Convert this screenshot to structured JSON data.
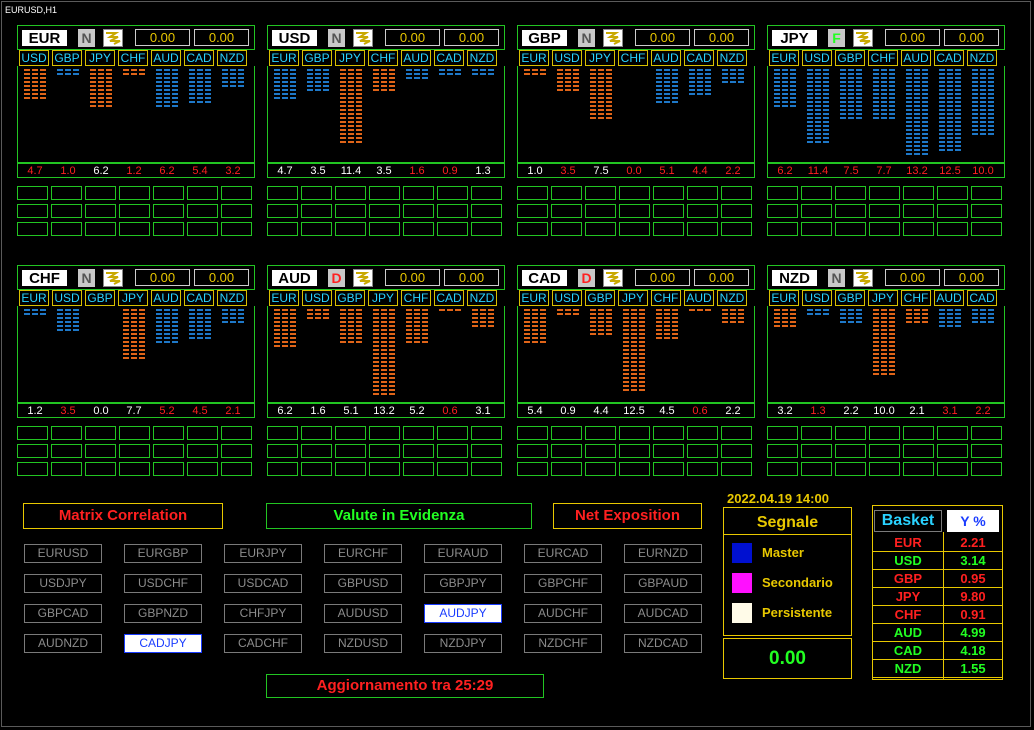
{
  "chart_title": "EURUSD,H1",
  "colors": {
    "green": "#22ff22",
    "red": "#ff2020",
    "yellow": "#e8c800",
    "cyan": "#29d2ff",
    "orange": "#e06418",
    "blue_bar": "#1e78c8",
    "white": "#ffffff"
  },
  "panels": [
    {
      "currency": "EUR",
      "status": "N",
      "val1": "0.00",
      "val2": "0.00",
      "tabs": [
        "USD",
        "GBP",
        "JPY",
        "CHF",
        "AUD",
        "CAD",
        "NZD"
      ],
      "values": [
        "4.7",
        "1.0",
        "6.2",
        "1.2",
        "6.2",
        "5.4",
        "3.2"
      ],
      "value_colors": [
        "red",
        "red",
        "white",
        "red",
        "red",
        "red",
        "red"
      ],
      "bars": [
        {
          "v": 4.7,
          "dir": "up"
        },
        {
          "v": 1.0,
          "dir": "down"
        },
        {
          "v": 6.2,
          "dir": "up"
        },
        {
          "v": 1.2,
          "dir": "up"
        },
        {
          "v": 6.2,
          "dir": "down"
        },
        {
          "v": 5.4,
          "dir": "down"
        },
        {
          "v": 3.2,
          "dir": "down"
        }
      ]
    },
    {
      "currency": "USD",
      "status": "N",
      "val1": "0.00",
      "val2": "0.00",
      "tabs": [
        "EUR",
        "GBP",
        "JPY",
        "CHF",
        "AUD",
        "CAD",
        "NZD"
      ],
      "values": [
        "4.7",
        "3.5",
        "11.4",
        "3.5",
        "1.6",
        "0.9",
        "1.3"
      ],
      "value_colors": [
        "white",
        "white",
        "white",
        "white",
        "red",
        "red",
        "white"
      ],
      "bars": [
        {
          "v": 4.7,
          "dir": "down"
        },
        {
          "v": 3.5,
          "dir": "down"
        },
        {
          "v": 11.4,
          "dir": "up"
        },
        {
          "v": 3.5,
          "dir": "up"
        },
        {
          "v": 1.6,
          "dir": "down"
        },
        {
          "v": 0.9,
          "dir": "down"
        },
        {
          "v": 1.3,
          "dir": "down"
        }
      ]
    },
    {
      "currency": "GBP",
      "status": "N",
      "val1": "0.00",
      "val2": "0.00",
      "tabs": [
        "EUR",
        "USD",
        "JPY",
        "CHF",
        "AUD",
        "CAD",
        "NZD"
      ],
      "values": [
        "1.0",
        "3.5",
        "7.5",
        "0.0",
        "5.1",
        "4.4",
        "2.2"
      ],
      "value_colors": [
        "white",
        "red",
        "white",
        "red",
        "red",
        "red",
        "red"
      ],
      "bars": [
        {
          "v": 1.0,
          "dir": "up"
        },
        {
          "v": 3.5,
          "dir": "up"
        },
        {
          "v": 7.5,
          "dir": "up"
        },
        {
          "v": 0.0,
          "dir": "up"
        },
        {
          "v": 5.1,
          "dir": "down"
        },
        {
          "v": 4.4,
          "dir": "down"
        },
        {
          "v": 2.2,
          "dir": "down"
        }
      ]
    },
    {
      "currency": "JPY",
      "status": "F",
      "val1": "0.00",
      "val2": "0.00",
      "tabs": [
        "EUR",
        "USD",
        "GBP",
        "CHF",
        "AUD",
        "CAD",
        "NZD"
      ],
      "values": [
        "6.2",
        "11.4",
        "7.5",
        "7.7",
        "13.2",
        "12.5",
        "10.0"
      ],
      "value_colors": [
        "red",
        "red",
        "red",
        "red",
        "red",
        "red",
        "red"
      ],
      "bars": [
        {
          "v": 6.2,
          "dir": "down"
        },
        {
          "v": 11.4,
          "dir": "down"
        },
        {
          "v": 7.5,
          "dir": "down"
        },
        {
          "v": 7.7,
          "dir": "down"
        },
        {
          "v": 13.2,
          "dir": "down"
        },
        {
          "v": 12.5,
          "dir": "down"
        },
        {
          "v": 10.0,
          "dir": "down"
        }
      ]
    },
    {
      "currency": "CHF",
      "status": "N",
      "val1": "0.00",
      "val2": "0.00",
      "tabs": [
        "EUR",
        "USD",
        "GBP",
        "JPY",
        "AUD",
        "CAD",
        "NZD"
      ],
      "values": [
        "1.2",
        "3.5",
        "0.0",
        "7.7",
        "5.2",
        "4.5",
        "2.1"
      ],
      "value_colors": [
        "white",
        "red",
        "white",
        "white",
        "red",
        "red",
        "red"
      ],
      "bars": [
        {
          "v": 1.2,
          "dir": "down"
        },
        {
          "v": 3.5,
          "dir": "down"
        },
        {
          "v": 0.0,
          "dir": "down"
        },
        {
          "v": 7.7,
          "dir": "up"
        },
        {
          "v": 5.2,
          "dir": "down"
        },
        {
          "v": 4.5,
          "dir": "down"
        },
        {
          "v": 2.1,
          "dir": "down"
        }
      ]
    },
    {
      "currency": "AUD",
      "status": "D",
      "val1": "0.00",
      "val2": "0.00",
      "tabs": [
        "EUR",
        "USD",
        "GBP",
        "JPY",
        "CHF",
        "CAD",
        "NZD"
      ],
      "values": [
        "6.2",
        "1.6",
        "5.1",
        "13.2",
        "5.2",
        "0.6",
        "3.1"
      ],
      "value_colors": [
        "white",
        "white",
        "white",
        "white",
        "white",
        "red",
        "white"
      ],
      "bars": [
        {
          "v": 6.2,
          "dir": "up"
        },
        {
          "v": 1.6,
          "dir": "up"
        },
        {
          "v": 5.1,
          "dir": "up"
        },
        {
          "v": 13.2,
          "dir": "up"
        },
        {
          "v": 5.2,
          "dir": "up"
        },
        {
          "v": 0.6,
          "dir": "up"
        },
        {
          "v": 3.1,
          "dir": "up"
        }
      ]
    },
    {
      "currency": "CAD",
      "status": "D",
      "val1": "0.00",
      "val2": "0.00",
      "tabs": [
        "EUR",
        "USD",
        "GBP",
        "JPY",
        "CHF",
        "AUD",
        "NZD"
      ],
      "values": [
        "5.4",
        "0.9",
        "4.4",
        "12.5",
        "4.5",
        "0.6",
        "2.2"
      ],
      "value_colors": [
        "white",
        "white",
        "white",
        "white",
        "white",
        "red",
        "white"
      ],
      "bars": [
        {
          "v": 5.4,
          "dir": "up"
        },
        {
          "v": 0.9,
          "dir": "up"
        },
        {
          "v": 4.4,
          "dir": "up"
        },
        {
          "v": 12.5,
          "dir": "up"
        },
        {
          "v": 4.5,
          "dir": "up"
        },
        {
          "v": 0.6,
          "dir": "up"
        },
        {
          "v": 2.2,
          "dir": "up"
        }
      ]
    },
    {
      "currency": "NZD",
      "status": "N",
      "val1": "0.00",
      "val2": "0.00",
      "tabs": [
        "EUR",
        "USD",
        "GBP",
        "JPY",
        "CHF",
        "AUD",
        "CAD"
      ],
      "values": [
        "3.2",
        "1.3",
        "2.2",
        "10.0",
        "2.1",
        "3.1",
        "2.2"
      ],
      "value_colors": [
        "white",
        "red",
        "white",
        "white",
        "white",
        "red",
        "red"
      ],
      "bars": [
        {
          "v": 3.2,
          "dir": "up"
        },
        {
          "v": 1.3,
          "dir": "down"
        },
        {
          "v": 2.2,
          "dir": "down"
        },
        {
          "v": 10.0,
          "dir": "up"
        },
        {
          "v": 2.1,
          "dir": "up"
        },
        {
          "v": 3.1,
          "dir": "down"
        },
        {
          "v": 2.2,
          "dir": "down"
        }
      ]
    }
  ],
  "buttons": {
    "matrix": "Matrix Correlation",
    "valute": "Valute in Evidenza",
    "net": "Net Exposition",
    "update": "Aggiornamento tra  25:29"
  },
  "pairs": [
    "EURUSD",
    "EURGBP",
    "EURJPY",
    "EURCHF",
    "EURAUD",
    "EURCAD",
    "EURNZD",
    "USDJPY",
    "USDCHF",
    "USDCAD",
    "GBPUSD",
    "GBPJPY",
    "GBPCHF",
    "GBPAUD",
    "GBPCAD",
    "GBPNZD",
    "CHFJPY",
    "AUDUSD",
    "AUDJPY",
    "AUDCHF",
    "AUDCAD",
    "AUDNZD",
    "CADJPY",
    "CADCHF",
    "NZDUSD",
    "NZDJPY",
    "NZDCHF",
    "NZDCAD"
  ],
  "selected_pairs": [
    "AUDJPY",
    "CADJPY"
  ],
  "signal": {
    "date": "2022.04.19 14:00",
    "title": "Segnale",
    "legend": [
      {
        "label": "Master",
        "color": "#0010d0"
      },
      {
        "label": "Secondario",
        "color": "#ff10ff"
      },
      {
        "label": "Persistente",
        "color": "#fffbe8"
      }
    ],
    "value": "0.00"
  },
  "basket": {
    "header": "Basket",
    "header_value": "Y %",
    "rows": [
      {
        "name": "EUR",
        "value": "2.21",
        "color": "red"
      },
      {
        "name": "USD",
        "value": "3.14",
        "color": "green"
      },
      {
        "name": "GBP",
        "value": "0.95",
        "color": "red"
      },
      {
        "name": "JPY",
        "value": "9.80",
        "color": "red"
      },
      {
        "name": "CHF",
        "value": "0.91",
        "color": "red"
      },
      {
        "name": "AUD",
        "value": "4.99",
        "color": "green"
      },
      {
        "name": "CAD",
        "value": "4.18",
        "color": "green"
      },
      {
        "name": "NZD",
        "value": "1.55",
        "color": "green"
      }
    ]
  }
}
